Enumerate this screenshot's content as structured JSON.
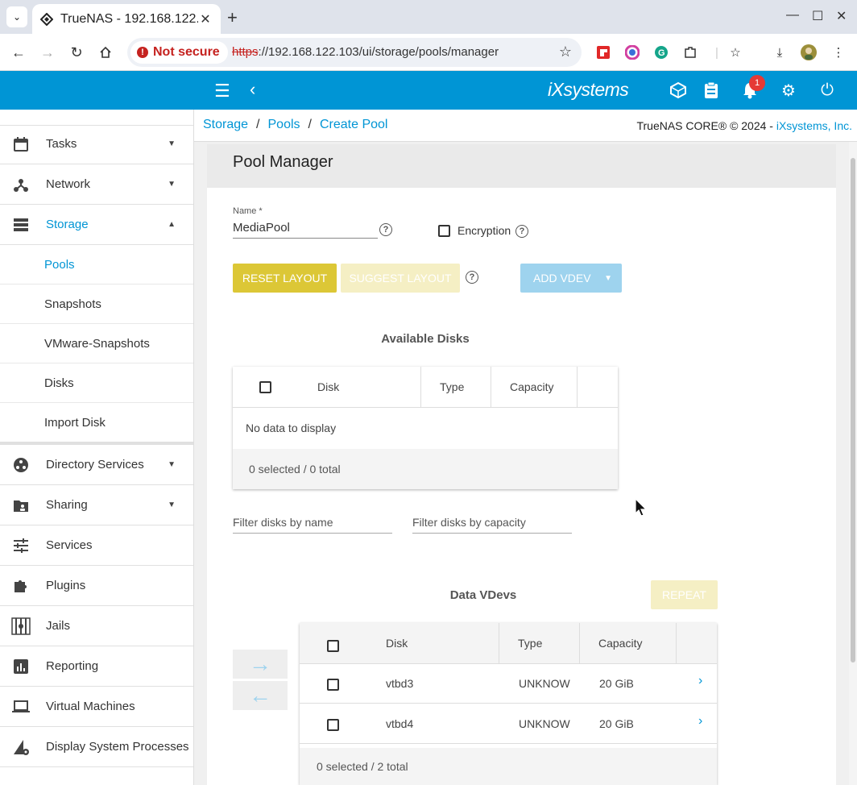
{
  "browser": {
    "tab_title": "TrueNAS - 192.168.122.103",
    "not_secure": "Not secure",
    "url_scheme": "https",
    "url_rest": "://192.168.122.103/ui/storage/pools/manager"
  },
  "header": {
    "logo": "iXsystems",
    "notification_count": "1"
  },
  "sidebar": {
    "items": [
      {
        "label": "Tasks"
      },
      {
        "label": "Network"
      },
      {
        "label": "Storage"
      },
      {
        "label": "Directory Services"
      },
      {
        "label": "Sharing"
      },
      {
        "label": "Services"
      },
      {
        "label": "Plugins"
      },
      {
        "label": "Jails"
      },
      {
        "label": "Reporting"
      },
      {
        "label": "Virtual Machines"
      },
      {
        "label": "Display System Processes"
      }
    ],
    "storage_sub": [
      {
        "label": "Pools"
      },
      {
        "label": "Snapshots"
      },
      {
        "label": "VMware-Snapshots"
      },
      {
        "label": "Disks"
      },
      {
        "label": "Import Disk"
      }
    ]
  },
  "breadcrumb": {
    "items": [
      "Storage",
      "Pools",
      "Create Pool"
    ],
    "separator": "/",
    "copyright_prefix": "TrueNAS CORE® © 2024 - ",
    "copyright_link": "iXsystems, Inc."
  },
  "pool_manager": {
    "title": "Pool Manager",
    "name_label": "Name *",
    "name_value": "MediaPool",
    "encryption_label": "Encryption",
    "buttons": {
      "reset": "RESET LAYOUT",
      "suggest": "SUGGEST LAYOUT",
      "add_vdev": "ADD VDEV",
      "repeat": "REPEAT"
    },
    "available_disks": {
      "title": "Available Disks",
      "columns": [
        "Disk",
        "Type",
        "Capacity"
      ],
      "empty": "No data to display",
      "footer": "0 selected / 0 total"
    },
    "filters": {
      "name": "Filter disks by name",
      "capacity": "Filter disks by capacity"
    },
    "data_vdevs": {
      "title": "Data VDevs",
      "columns": [
        "Disk",
        "Type",
        "Capacity"
      ],
      "rows": [
        {
          "disk": "vtbd3",
          "type": "UNKNOW",
          "capacity": "20 GiB"
        },
        {
          "disk": "vtbd4",
          "type": "UNKNOW",
          "capacity": "20 GiB"
        }
      ],
      "footer": "0 selected / 2 total"
    }
  },
  "colors": {
    "brand_blue": "#0095d5",
    "accent_yellow": "#dcc736"
  }
}
